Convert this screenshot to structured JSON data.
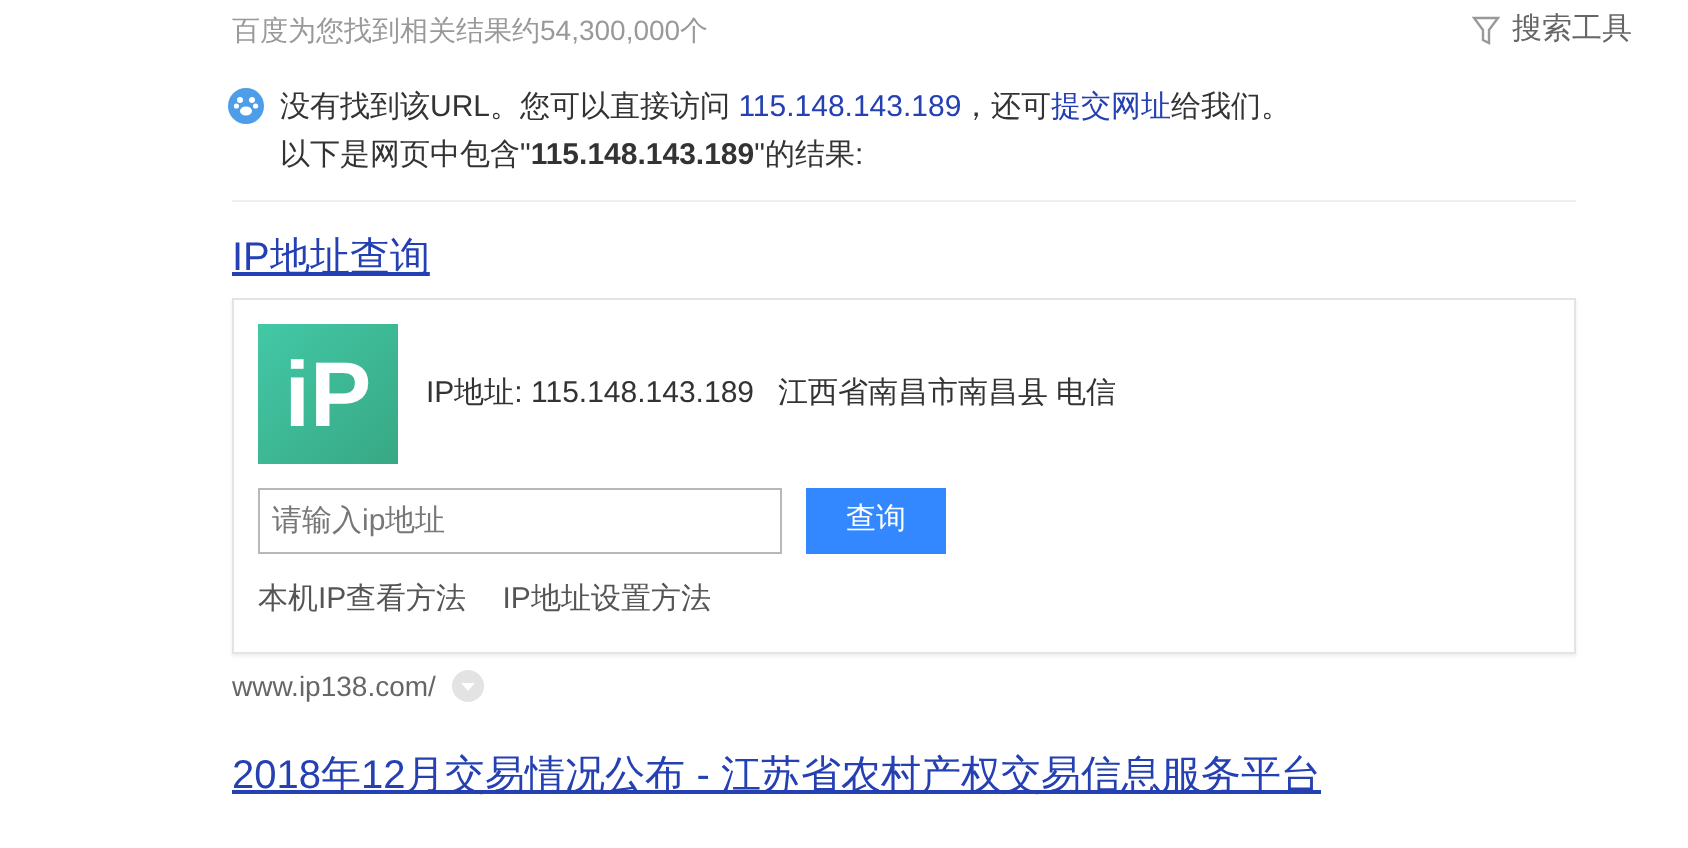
{
  "result_count": "百度为您找到相关结果约54,300,000个",
  "search_tools": "搜索工具",
  "notice": {
    "before": "没有找到该URL。您可以直接访问 ",
    "ip_link": "115.148.143.189",
    "middle": "，还可",
    "submit_link": "提交网址",
    "after": "给我们。",
    "second_line": "以下是网页中包含\"**115.148.143.189**\"的结果:"
  },
  "results": [
    {
      "kind": "ip_card",
      "title": "IP地址查询",
      "logo": "iP",
      "ip_label": "IP地址: 115.148.143.189",
      "location": "江西省南昌市南昌县 电信",
      "input": {
        "placeholder": "请输入ip地址"
      },
      "button": "查询",
      "links": [
        "本机IP查看方法",
        "IP地址设置方法"
      ],
      "url": "www.ip138.com/"
    },
    {
      "kind": "plain",
      "title": "2018年12月交易情况公布 - 江苏省农村产权交易信息服务平台"
    }
  ]
}
